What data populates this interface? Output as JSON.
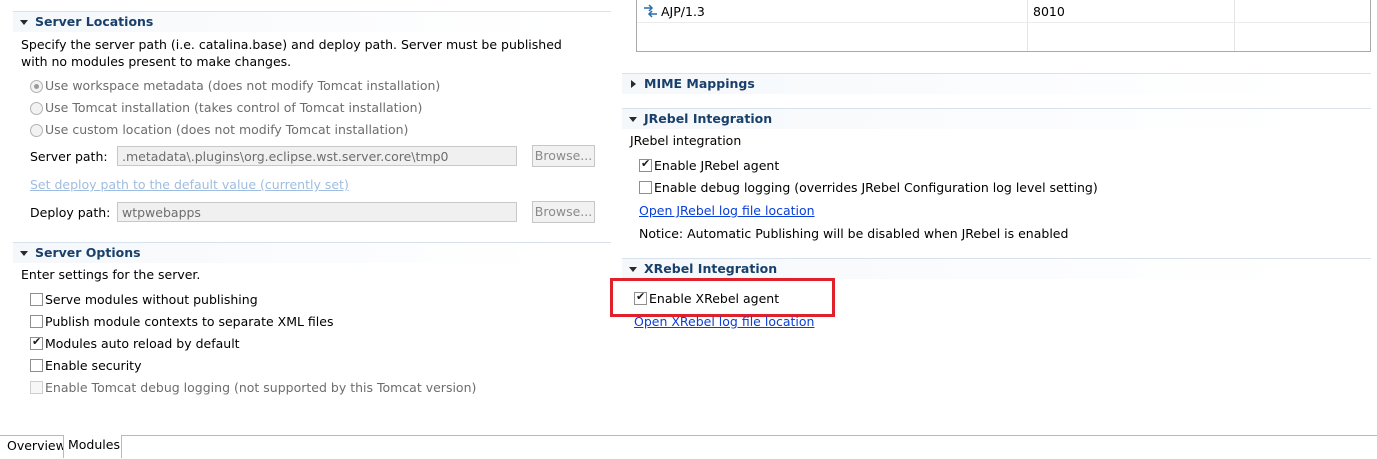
{
  "server_locations": {
    "title": "Server Locations",
    "description": "Specify the server path (i.e. catalina.base) and deploy path. Server must be published with no modules present to make changes.",
    "options": [
      {
        "label": "Use workspace metadata (does not modify Tomcat installation)",
        "selected": true
      },
      {
        "label": "Use Tomcat installation (takes control of Tomcat installation)",
        "selected": false
      },
      {
        "label": "Use custom location (does not modify Tomcat installation)",
        "selected": false
      }
    ],
    "server_path_label": "Server path:",
    "server_path_value": ".metadata\\.plugins\\org.eclipse.wst.server.core\\tmp0",
    "browse_label": "Browse...",
    "set_deploy_link": "Set deploy path to the default value (currently set)",
    "deploy_path_label": "Deploy path:",
    "deploy_path_value": "wtpwebapps"
  },
  "server_options": {
    "title": "Server Options",
    "description": "Enter settings for the server.",
    "options": [
      {
        "label": "Serve modules without publishing",
        "checked": false
      },
      {
        "label": "Publish module contexts to separate XML files",
        "checked": false
      },
      {
        "label": "Modules auto reload by default",
        "checked": true
      },
      {
        "label": "Enable security",
        "checked": false
      },
      {
        "label": "Enable Tomcat debug logging (not supported by this Tomcat version)",
        "checked": false,
        "disabled": true
      }
    ]
  },
  "ports_table": {
    "row": {
      "name": "AJP/1.3",
      "port": "8010",
      "icon": "connector-icon"
    }
  },
  "mime_mappings": {
    "title": "MIME Mappings"
  },
  "jrebel": {
    "title": "JRebel Integration",
    "subtitle": "JRebel integration",
    "enable_agent": "Enable JRebel agent",
    "enable_debug": "Enable debug logging (overrides JRebel Configuration log level setting)",
    "log_link": "Open JRebel log file location",
    "notice": "Notice: Automatic Publishing will be disabled when JRebel is enabled"
  },
  "xrebel": {
    "title": "XRebel Integration",
    "enable_agent": "Enable XRebel agent",
    "log_link": "Open XRebel log file location",
    "highlight_color": "#e0202a"
  },
  "tabs": [
    {
      "label": "Overview",
      "active": false
    },
    {
      "label": "Modules",
      "active": true
    }
  ]
}
